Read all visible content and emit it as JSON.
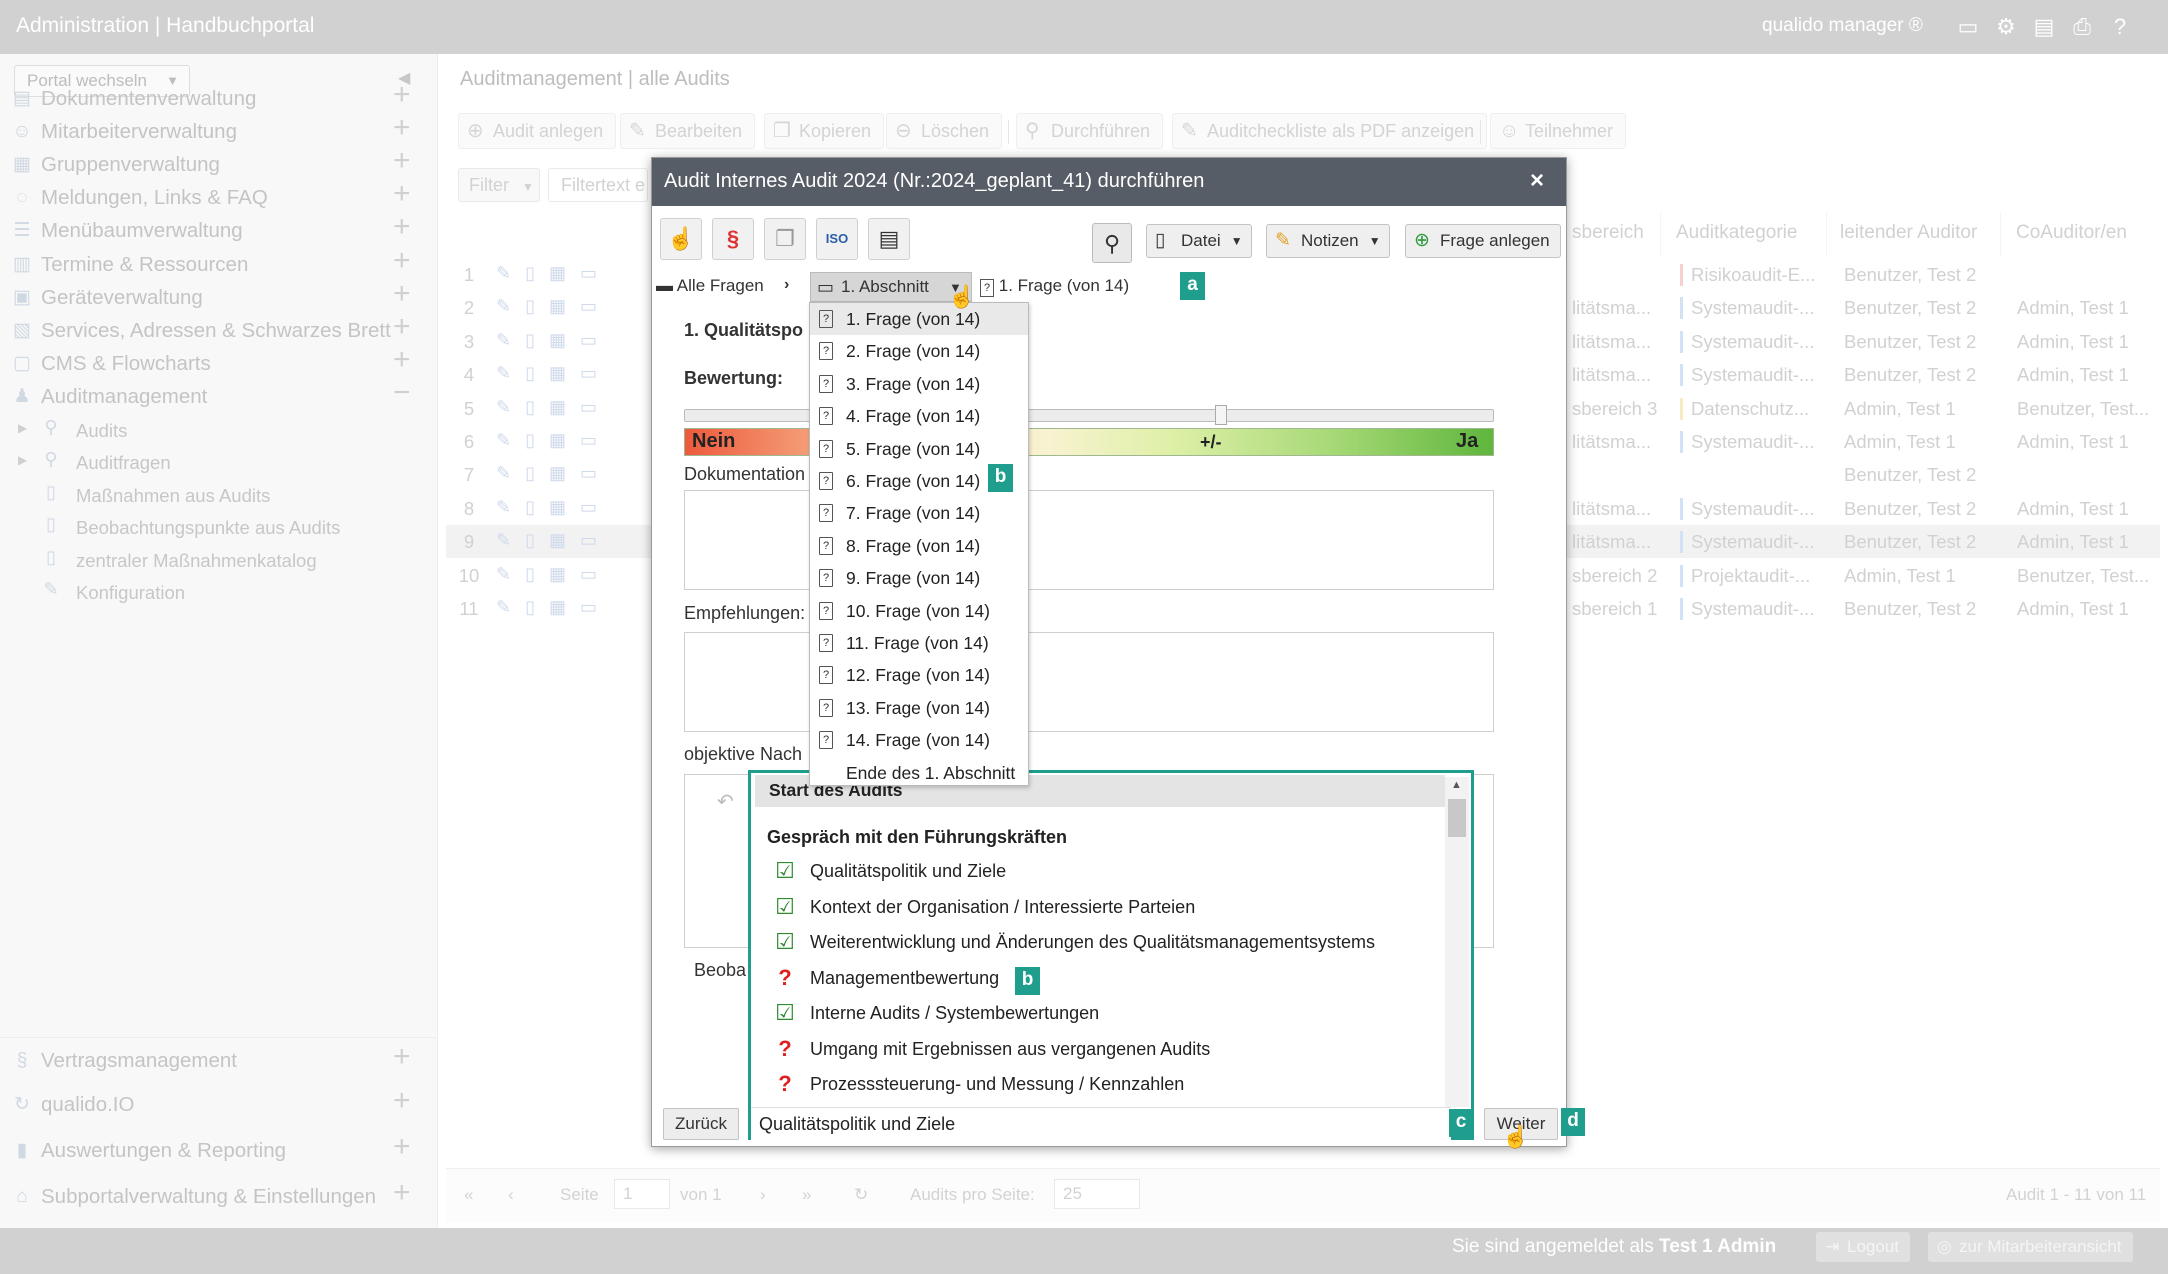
{
  "app": {
    "title": "Administration | Handbuchportal",
    "brand": "qualido manager ®",
    "top_icons": [
      "monitor-icon",
      "network-icon",
      "document-stack-icon",
      "print-icon",
      "help-icon"
    ]
  },
  "sidebar": {
    "portal_switch": "Portal wechseln",
    "items": [
      {
        "label": "Dokumentenverwaltung",
        "icon": "document-icon",
        "expander": "+"
      },
      {
        "label": "Mitarbeiterverwaltung",
        "icon": "users-icon",
        "expander": "+"
      },
      {
        "label": "Gruppenverwaltung",
        "icon": "group-icon",
        "expander": "+"
      },
      {
        "label": "Meldungen, Links & FAQ",
        "icon": "chat-icon",
        "expander": "+"
      },
      {
        "label": "Menübaumverwaltung",
        "icon": "list-icon",
        "expander": "+"
      },
      {
        "label": "Termine & Ressourcen",
        "icon": "calendar-icon",
        "expander": "+"
      },
      {
        "label": "Geräteverwaltung",
        "icon": "device-icon",
        "expander": "+"
      },
      {
        "label": "Services, Adressen & Schwarzes Brett",
        "icon": "board-icon",
        "expander": "+"
      },
      {
        "label": "CMS & Flowcharts",
        "icon": "cms-icon",
        "expander": "+"
      },
      {
        "label": "Auditmanagement",
        "icon": "audit-icon",
        "expander": "−"
      }
    ],
    "audit_sub": [
      {
        "label": "Audits",
        "icon": "audit-person-icon"
      },
      {
        "label": "Auditfragen",
        "icon": "question-search-icon"
      },
      {
        "label": "Maßnahmen aus Audits",
        "icon": "page-icon"
      },
      {
        "label": "Beobachtungspunkte aus Audits",
        "icon": "page-icon"
      },
      {
        "label": "zentraler Maßnahmenkatalog",
        "icon": "page-icon"
      },
      {
        "label": "Konfiguration",
        "icon": "wrench-icon"
      }
    ],
    "bottom_items": [
      {
        "label": "Vertragsmanagement",
        "icon": "paragraph-icon",
        "expander": "+"
      },
      {
        "label": "qualido.IO",
        "icon": "sync-icon",
        "expander": "+"
      },
      {
        "label": "Auswertungen & Reporting",
        "icon": "chart-icon",
        "expander": "+"
      },
      {
        "label": "Subportalverwaltung & Einstellungen",
        "icon": "home-gear-icon",
        "expander": "+"
      }
    ]
  },
  "main": {
    "breadcrumb": "Auditmanagement | alle Audits",
    "toolbar": {
      "add": "Audit anlegen",
      "edit": "Bearbeiten",
      "copy": "Kopieren",
      "delete": "Löschen",
      "run": "Durchführen",
      "pdf": "Auditcheckliste als PDF anzeigen",
      "participants": "Teilnehmer"
    },
    "filter": "Filter",
    "filter_placeholder": "Filtertext e",
    "columns": [
      "sbereich",
      "Auditkategorie",
      "leitender Auditor",
      "CoAuditor/en"
    ],
    "rows": [
      {
        "num": "1",
        "bereich": "",
        "kategorie": "Risikoaudit-E...",
        "auditor": "Benutzer, Test 2",
        "coauditor": ""
      },
      {
        "num": "2",
        "bereich": "litätsma...",
        "kategorie": "Systemaudit-...",
        "auditor": "Benutzer, Test 2",
        "coauditor": "Admin, Test 1"
      },
      {
        "num": "3",
        "bereich": "litätsma...",
        "kategorie": "Systemaudit-...",
        "auditor": "Benutzer, Test 2",
        "coauditor": "Admin, Test 1"
      },
      {
        "num": "4",
        "bereich": "litätsma...",
        "kategorie": "Systemaudit-...",
        "auditor": "Benutzer, Test 2",
        "coauditor": "Admin, Test 1"
      },
      {
        "num": "5",
        "bereich": "sbereich 3",
        "kategorie": "Datenschutz...",
        "auditor": "Admin, Test 1",
        "coauditor": "Benutzer, Test..."
      },
      {
        "num": "6",
        "bereich": "litätsma...",
        "kategorie": "Systemaudit-...",
        "auditor": "Admin, Test 1",
        "coauditor": "Admin, Test 1"
      },
      {
        "num": "7",
        "bereich": "",
        "kategorie": "",
        "auditor": "Benutzer, Test 2",
        "coauditor": ""
      },
      {
        "num": "8",
        "bereich": "litätsma...",
        "kategorie": "Systemaudit-...",
        "auditor": "Benutzer, Test 2",
        "coauditor": "Admin, Test 1"
      },
      {
        "num": "9",
        "bereich": "litätsma...",
        "kategorie": "Systemaudit-...",
        "auditor": "Benutzer, Test 2",
        "coauditor": "Admin, Test 1"
      },
      {
        "num": "10",
        "bereich": "sbereich 2",
        "kategorie": "Projektaudit-...",
        "auditor": "Admin, Test 1",
        "coauditor": "Benutzer, Test..."
      },
      {
        "num": "11",
        "bereich": "sbereich 1",
        "kategorie": "Systemaudit-...",
        "auditor": "Benutzer, Test 2",
        "coauditor": "Admin, Test 1"
      }
    ],
    "pager": {
      "page_label": "Seite",
      "page_value": "1",
      "of_label": "von 1",
      "per_page_label": "Audits pro Seite:",
      "per_page_value": "25",
      "summary": "Audit 1 - 11 von 11"
    }
  },
  "modal": {
    "title": "Audit Internes Audit 2024 (Nr.:2024_geplant_41) durchführen",
    "close": "×",
    "file_label": "Datei",
    "notes_label": "Notizen",
    "add_question_label": "Frage anlegen",
    "breadcrumb": {
      "all": "Alle Fragen",
      "section": "1. Abschnitt",
      "question": "1. Frage (von 14)"
    },
    "question_heading": "1. Qualitätspo",
    "rating_label": "Bewertung:",
    "scale": {
      "low": "Nein",
      "mid": "+/-",
      "high": "Ja"
    },
    "fields": {
      "documentation": "Dokumentation",
      "recommendations": "Empfehlungen:",
      "evidence": "objektive Nach",
      "observations": "Beoba"
    },
    "back": "Zurück",
    "next": "Weiter",
    "badges": {
      "a": "a",
      "b": "b",
      "c": "c",
      "d": "d"
    }
  },
  "dropdown": {
    "items": [
      "1. Frage (von 14)",
      "2. Frage (von 14)",
      "3. Frage (von 14)",
      "4. Frage (von 14)",
      "5. Frage (von 14)",
      "6. Frage (von 14)",
      "7. Frage (von 14)",
      "8. Frage (von 14)",
      "9. Frage (von 14)",
      "10. Frage (von 14)",
      "11. Frage (von 14)",
      "12. Frage (von 14)",
      "13. Frage (von 14)",
      "14. Frage (von 14)"
    ],
    "end": "Ende des 1. Abschnitt",
    "question_icon": "?"
  },
  "overview": {
    "header": "Start des Audits",
    "group": "Gespräch mit den Führungskräften",
    "items": [
      {
        "label": "Qualitätspolitik und Ziele",
        "status": "done"
      },
      {
        "label": "Kontext der Organisation / Interessierte Parteien",
        "status": "done"
      },
      {
        "label": "Weiterentwicklung und Änderungen des Qualitätsmanagementsystems",
        "status": "done"
      },
      {
        "label": "Managementbewertung",
        "status": "open"
      },
      {
        "label": "Interne Audits / Systembewertungen",
        "status": "done"
      },
      {
        "label": "Umgang mit Ergebnissen aus vergangenen Audits",
        "status": "open"
      },
      {
        "label": "Prozesssteuerung- und Messung / Kennzahlen",
        "status": "open"
      }
    ],
    "current": "Qualitätspolitik und Ziele",
    "status_glyphs": {
      "done": "☑",
      "open": "?"
    }
  },
  "status": {
    "logged_prefix": "Sie sind angemeldet als",
    "user": "Test 1 Admin",
    "logout": "Logout",
    "employee_view": "zur Mitarbeiteransicht"
  },
  "colors": {
    "accent": "#1f9e8e",
    "header_bar": "#b8b8b8",
    "modal_head": "#575d66",
    "ok": "#2e8b2e",
    "open": "#dd2020"
  }
}
